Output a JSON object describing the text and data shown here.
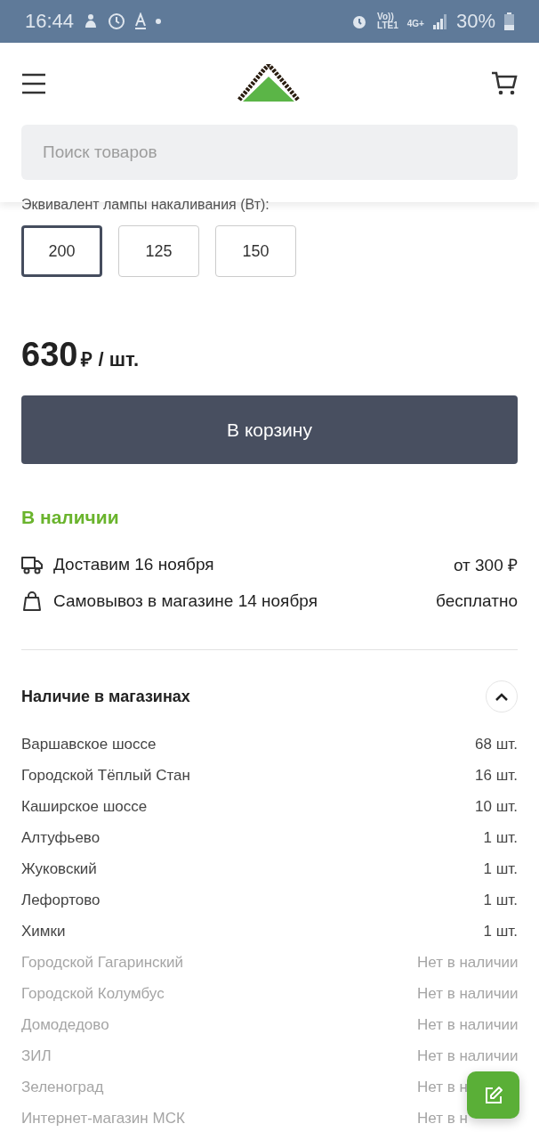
{
  "status_bar": {
    "time": "16:44",
    "volte": "Vo))",
    "lte": "LTE1",
    "network": "4G+",
    "battery": "30%"
  },
  "header": {
    "search": {
      "placeholder": "Поиск товаров"
    }
  },
  "option_group": {
    "label": "Эквивалент лампы накаливания (Вт):",
    "options": [
      {
        "label": "200",
        "selected": true
      },
      {
        "label": "125",
        "selected": false
      },
      {
        "label": "150",
        "selected": false
      }
    ]
  },
  "price": {
    "amount": "630",
    "unit": "₽ / шт."
  },
  "cart_button": "В корзину",
  "availability": {
    "status": "В наличии",
    "rows": [
      {
        "kind": "delivery",
        "label": "Доставим 16 ноября",
        "value": "от 300 ₽"
      },
      {
        "kind": "pickup",
        "label": "Самовывоз в магазине 14 ноября",
        "value": "бесплатно"
      }
    ]
  },
  "stores": {
    "title": "Наличие в магазинах",
    "expanded": true,
    "rows": [
      {
        "name": "Варшавское шоссе",
        "count": "68 шт.",
        "available": true
      },
      {
        "name": "Городской Тёплый Стан",
        "count": "16 шт.",
        "available": true
      },
      {
        "name": "Каширское шоссе",
        "count": "10 шт.",
        "available": true
      },
      {
        "name": "Алтуфьево",
        "count": "1 шт.",
        "available": true
      },
      {
        "name": "Жуковский",
        "count": "1 шт.",
        "available": true
      },
      {
        "name": "Лефортово",
        "count": "1 шт.",
        "available": true
      },
      {
        "name": "Химки",
        "count": "1 шт.",
        "available": true
      },
      {
        "name": "Городской Гагаринский",
        "count": "Нет в наличии",
        "available": false
      },
      {
        "name": "Городской Колумбус",
        "count": "Нет в наличии",
        "available": false
      },
      {
        "name": "Домодедово",
        "count": "Нет в наличии",
        "available": false
      },
      {
        "name": "ЗИЛ",
        "count": "Нет в наличии",
        "available": false
      },
      {
        "name": "Зеленоград",
        "count": "Нет в н",
        "available": false
      },
      {
        "name": "Интернет-магазин МСК",
        "count": "Нет в н",
        "available": false
      }
    ]
  }
}
